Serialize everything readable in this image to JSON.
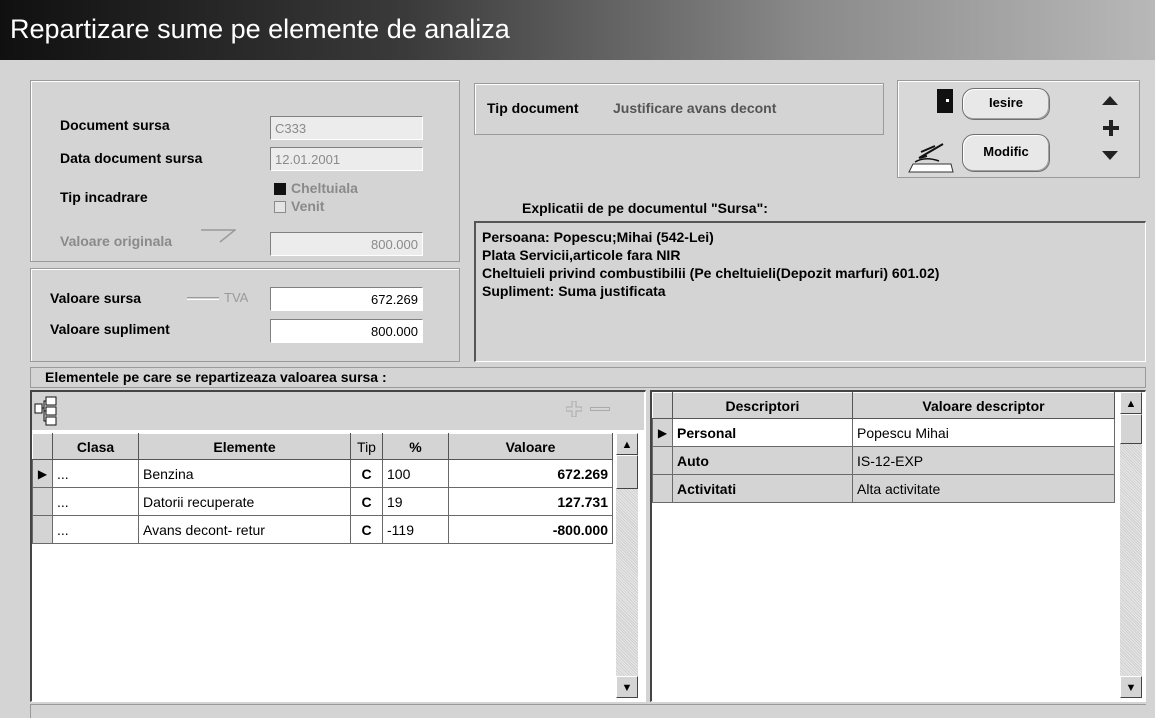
{
  "window": {
    "title": "Repartizare sume pe elemente de analiza"
  },
  "source": {
    "doc_label": "Document sursa",
    "doc_value": "C333",
    "date_label": "Data document sursa",
    "date_value": "12.01.2001",
    "type_label": "Tip incadrare",
    "opt_expense": "Cheltuiala",
    "opt_income": "Venit",
    "orig_label": "Valoare originala",
    "orig_value": "800.000",
    "src_label": "Valoare sursa",
    "tva_label": "TVA",
    "src_value": "672.269",
    "sup_label": "Valoare supliment",
    "sup_value": "800.000"
  },
  "doctype": {
    "label": "Tip document",
    "value": "Justificare avans decont"
  },
  "buttons": {
    "exit": "Iesire",
    "modify": "Modific"
  },
  "explain": {
    "title": "Explicatii de pe documentul \"Sursa\":",
    "lines": [
      "Persoana: Popescu;Mihai (542-Lei)",
      "Plata Servicii,articole fara NIR",
      "Cheltuieli privind combustibilii (Pe cheltuieli(Depozit marfuri) 601.02)",
      "Supliment: Suma justificata"
    ]
  },
  "section": {
    "title": "Elementele pe care se repartizeaza valoarea sursa  :"
  },
  "elements": {
    "headers": {
      "clasa": "Clasa",
      "elemente": "Elemente",
      "tip": "Tip",
      "pct": "%",
      "valoare": "Valoare"
    },
    "rows": [
      {
        "clasa": "...",
        "element": "Benzina",
        "tip": "C",
        "pct": "100",
        "valoare": "672.269"
      },
      {
        "clasa": "...",
        "element": "Datorii recuperate",
        "tip": "C",
        "pct": "19",
        "valoare": "127.731"
      },
      {
        "clasa": "...",
        "element": "Avans decont- retur",
        "tip": "C",
        "pct": "-119",
        "valoare": "-800.000"
      }
    ]
  },
  "descriptors": {
    "headers": {
      "desc": "Descriptori",
      "val": "Valoare descriptor"
    },
    "rows": [
      {
        "desc": "Personal",
        "val": "Popescu Mihai"
      },
      {
        "desc": "Auto",
        "val": "IS-12-EXP"
      },
      {
        "desc": "Activitati",
        "val": "Alta activitate"
      }
    ]
  }
}
